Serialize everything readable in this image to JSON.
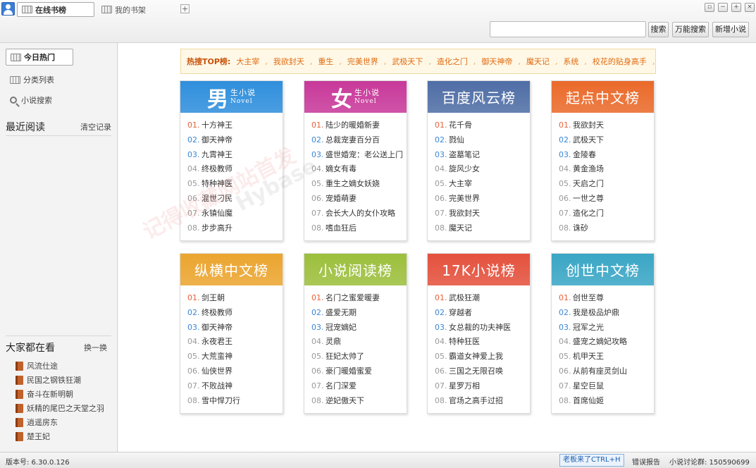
{
  "tabs": {
    "active": "在线书榜",
    "inactive": "我的书架",
    "add": "+"
  },
  "window_controls": [
    "▫",
    "−",
    "+",
    "×"
  ],
  "toolbar": {
    "search_value": "",
    "search_button": "搜索",
    "power_search_button": "万能搜索",
    "add_novel_button": "新增小说"
  },
  "sidebar": {
    "nav": [
      "今日热门",
      "分类列表",
      "小说搜索"
    ],
    "recent_title": "最近阅读",
    "clear_label": "清空记录",
    "watching_title": "大家都在看",
    "refresh_label": "换一换",
    "watching": [
      "风流仕途",
      "民国之钢铁狂潮",
      "奋斗在新明朝",
      "妖精的尾巴之天堂之羽",
      "逍遥房东",
      "楚王妃"
    ]
  },
  "hot": {
    "label": "热搜TOP榜:",
    "items": [
      "大主宰",
      "我欲封天",
      "重生",
      "完美世界",
      "武极天下",
      "造化之门",
      "御天神帝",
      "魔天记",
      "系统",
      "校花的贴身高手"
    ]
  },
  "watermark": {
    "cn": "记得收藏网站首发",
    "en": "Hybase"
  },
  "boards": [
    {
      "title_big": "男",
      "title_small": "生小说",
      "title_en": "Novel",
      "color": "#2f8fdc",
      "books": [
        "十方神王",
        "御天神帝",
        "九霄神王",
        "终极教师",
        "特种神医",
        "混世刁民",
        "永镇仙魔",
        "步步高升"
      ]
    },
    {
      "title_big": "女",
      "title_small": "生小说",
      "title_en": "Novel",
      "color": "#c8399a",
      "books": [
        "陆少的暖婚新妻",
        "总裁宠妻百分百",
        "盛世婚宠：老公送上门",
        "嫡女有毒",
        "重生之嫡女妖娆",
        "宠婚萌妻",
        "会长大人的女仆攻略",
        "嗜血狂后"
      ]
    },
    {
      "title": "百度风云榜",
      "color": "#4f6ea6",
      "books": [
        "花千骨",
        "戮仙",
        "盗墓笔记",
        "旋风少女",
        "大主宰",
        "完美世界",
        "我欲封天",
        "魔天记"
      ]
    },
    {
      "title": "起点中文榜",
      "color": "#ea6a2a",
      "books": [
        "我欲封天",
        "武极天下",
        "金陵春",
        "黄金渔场",
        "天启之门",
        "一世之尊",
        "造化之门",
        "诛砂"
      ]
    },
    {
      "title": "纵横中文榜",
      "color": "#eba52f",
      "books": [
        "剑王朝",
        "终极教师",
        "御天神帝",
        "永夜君王",
        "大荒蛮神",
        "仙侠世界",
        "不败战神",
        "雪中悍刀行"
      ]
    },
    {
      "title": "小说阅读榜",
      "color": "#9cbf3c",
      "books": [
        "名门之蜜爱暖妻",
        "盛爱无期",
        "冠宠嫡妃",
        "灵鼎",
        "狂妃太帅了",
        "豪门暖婚蜜爱",
        "名门深爱",
        "逆妃傲天下"
      ]
    },
    {
      "title": "17K小说榜",
      "color": "#e4513d",
      "books": [
        "武极狂潮",
        "穿越者",
        "女总裁的功夫神医",
        "特种狂医",
        "霸道女神爱上我",
        "三国之无限召唤",
        "星罗万相",
        "官场之高手过招"
      ]
    },
    {
      "title": "创世中文榜",
      "color": "#3aa6c5",
      "books": [
        "创世至尊",
        "我是极品炉鼎",
        "冠军之光",
        "盛宠之嫡妃攻略",
        "机甲天王",
        "从前有座灵剑山",
        "星空巨鼠",
        "首席仙姬"
      ]
    }
  ],
  "nums": [
    "01.",
    "02.",
    "03.",
    "04.",
    "05.",
    "06.",
    "07.",
    "08."
  ],
  "status": {
    "version": "版本号: 6.30.0.126",
    "boss": "老板来了CTRL+H",
    "report": "错误报告",
    "group": "小说讨论群: 150590699"
  }
}
